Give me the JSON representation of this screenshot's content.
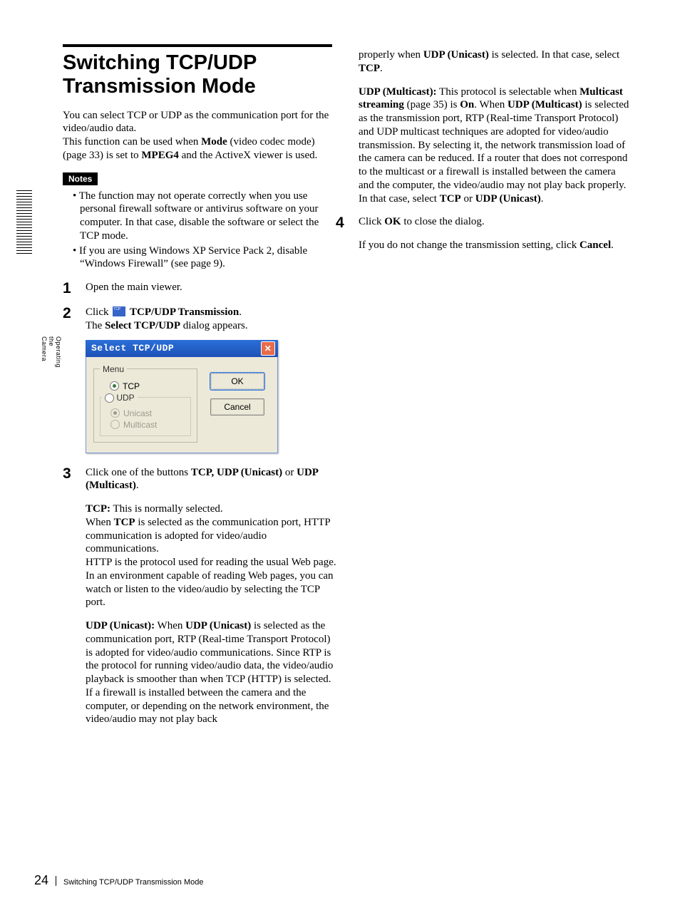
{
  "side_tab": {
    "label": "Operating the Camera"
  },
  "heading": "Switching TCP/UDP Transmission Mode",
  "intro": {
    "p1a": "You can select TCP or UDP as the communication port for the video/audio data.",
    "p1b_pre": "This function can be used when ",
    "p1b_b1": "Mode",
    "p1b_mid": " (video codec mode) (page 33) is set to ",
    "p1b_b2": "MPEG4",
    "p1b_post": " and the ActiveX viewer is used."
  },
  "notes_label": "Notes",
  "notes": [
    "The function may not operate correctly when you use personal firewall software or antivirus software on your computer. In that case, disable the software or select the TCP mode.",
    "If you are using Windows XP Service Pack 2, disable “Windows Firewall” (see page 9)."
  ],
  "steps": {
    "s1": {
      "num": "1",
      "text": "Open the main viewer."
    },
    "s2": {
      "num": "2",
      "line1_pre": "Click ",
      "line1_b": "TCP/UDP Transmission",
      "line1_post": ".",
      "line2_pre": "The ",
      "line2_b": "Select TCP/UDP",
      "line2_post": " dialog appears."
    },
    "s3": {
      "num": "3",
      "intro_pre": "Click one of the buttons ",
      "intro_b1": "TCP, UDP (Unicast)",
      "intro_mid": " or ",
      "intro_b2": "UDP (Multicast)",
      "intro_post": ".",
      "tcp_label": "TCP:",
      "tcp_l1": " This is normally selected.",
      "tcp_l2_pre": "When ",
      "tcp_l2_b": "TCP",
      "tcp_l2_post": " is selected as the communication port, HTTP communication is adopted for video/audio communications.",
      "tcp_l3": "HTTP is the protocol used for reading the usual Web page.",
      "tcp_l4": "In an environment capable of reading Web pages, you can watch or listen to the video/audio by selecting  the TCP port.",
      "uni_label": "UDP (Unicast):",
      "uni_pre": " When ",
      "uni_b1": "UDP (Unicast)",
      "uni_mid1": " is selected as the communication port, RTP (Real-time Transport Protocol) is adopted for video/audio communications. Since RTP is the protocol for running video/audio data, the video/audio playback is  smoother than when TCP (HTTP) is selected. If a firewall is installed between the camera and the computer, or depending on the network environment, the video/audio may not play back ",
      "uni_col2_pre": "properly when ",
      "uni_col2_b": "UDP (Unicast)",
      "uni_col2_mid": " is selected. In that case, select ",
      "uni_col2_b2": "TCP",
      "uni_col2_post": ".",
      "multi_label": "UDP (Multicast):",
      "multi_pre": " This protocol is selectable when ",
      "multi_b1": "Multicast streaming",
      "multi_mid1": " (page 35) is ",
      "multi_b2": "On",
      "multi_mid2": ". When ",
      "multi_b3": "UDP (Multicast)",
      "multi_mid3": " is selected as the transmission port, RTP (Real-time Transport Protocol) and UDP multicast techniques are adopted for video/audio transmission. By selecting it, the network transmission load of the camera can be reduced. If a router that does not correspond to the multicast or a firewall is installed between the camera and the computer, the video/audio may not play back properly. In that case, select ",
      "multi_b4": "TCP",
      "multi_mid4": " or ",
      "multi_b5": "UDP (Unicast)",
      "multi_post": "."
    },
    "s4": {
      "num": "4",
      "line1_pre": "Click ",
      "line1_b": "OK",
      "line1_post": " to close the dialog.",
      "line2_pre": "If you do not change the transmission setting, click ",
      "line2_b": "Cancel",
      "line2_post": "."
    }
  },
  "dialog": {
    "title": "Select TCP/UDP",
    "menu_legend": "Menu",
    "opt_tcp": "TCP",
    "opt_udp": "UDP",
    "opt_unicast": "Unicast",
    "opt_multicast": "Multicast",
    "btn_ok": "OK",
    "btn_cancel": "Cancel"
  },
  "footer": {
    "page_num": "24",
    "title": "Switching TCP/UDP Transmission Mode"
  }
}
